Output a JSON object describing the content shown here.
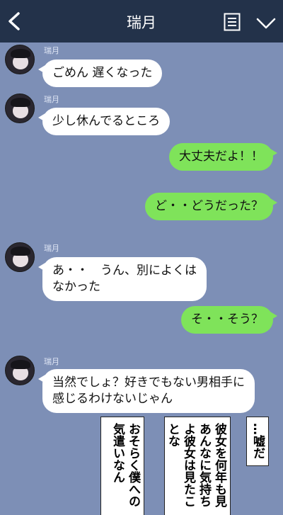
{
  "header": {
    "title": "瑞月"
  },
  "messages": [
    {
      "side": "in",
      "sender": "瑞月",
      "text": "ごめん 遅くなった"
    },
    {
      "side": "in",
      "sender": "瑞月",
      "text": "少し休んでるところ"
    },
    {
      "side": "out",
      "text": "大丈夫だよ！！"
    },
    {
      "side": "out",
      "text": "ど・・どうだった？"
    },
    {
      "side": "in",
      "sender": "瑞月",
      "line1": "あ・・　うん、別によくは",
      "line2": "なかった"
    },
    {
      "side": "out",
      "text": "そ・・そう？"
    },
    {
      "side": "in",
      "sender": "瑞月",
      "line1": "当然でしょ？好きでもない男相手に",
      "line2": "感じるわけないじゃん"
    }
  ],
  "narration": {
    "box1": "おそらく僕への気遣いなん",
    "box2": "彼女を何年も見あんなに気持ちよ彼女は見たことな",
    "box3": "…嘘だ"
  }
}
